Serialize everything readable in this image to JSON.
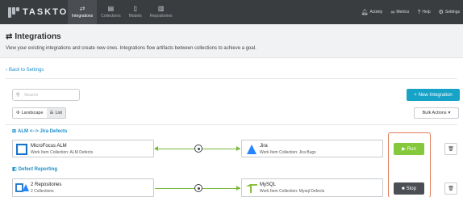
{
  "app": {
    "logo_text": "TASKTOP"
  },
  "nav": {
    "items": [
      {
        "label": "Integrations",
        "icon": "swap-arrows-icon",
        "active": true
      },
      {
        "label": "Collections",
        "icon": "collection-icon",
        "active": false
      },
      {
        "label": "Models",
        "icon": "document-icon",
        "active": false
      },
      {
        "label": "Repositories",
        "icon": "repository-icon",
        "active": false
      }
    ]
  },
  "util": {
    "activity": "Activity",
    "metrics": "Metrics",
    "help": "Help",
    "settings": "Settings"
  },
  "page": {
    "title": "Integrations",
    "description": "View your existing integrations and create new ones. Integrations flow artifacts between collections to achieve a goal.",
    "back_link": "Back to Settings"
  },
  "toolbar": {
    "search_placeholder": "Search",
    "new_integration": "New Integration",
    "view_landscape": "Landscape",
    "view_list": "List",
    "bulk_actions": "Bulk Actions"
  },
  "integrations": [
    {
      "title": "ALM <--> Jira Defects",
      "left_name": "MicroFocus ALM",
      "left_sub": "Work Item Collection: ALM Defects",
      "right_name": "Jira",
      "right_sub": "Work Item Collection: Jira Bugs",
      "action": "Run"
    },
    {
      "title": "Defect Reporting",
      "left_name": "2 Repositories",
      "left_sub": "2 Collections",
      "right_name": "MySQL",
      "right_sub": "Work Item Collection: Mysql Defects",
      "action": "Stop"
    }
  ],
  "colors": {
    "accent": "#17a2c8",
    "run": "#86c83c",
    "stop": "#4b4f53",
    "highlight": "#e07b58",
    "link": "#1a8fc7"
  }
}
